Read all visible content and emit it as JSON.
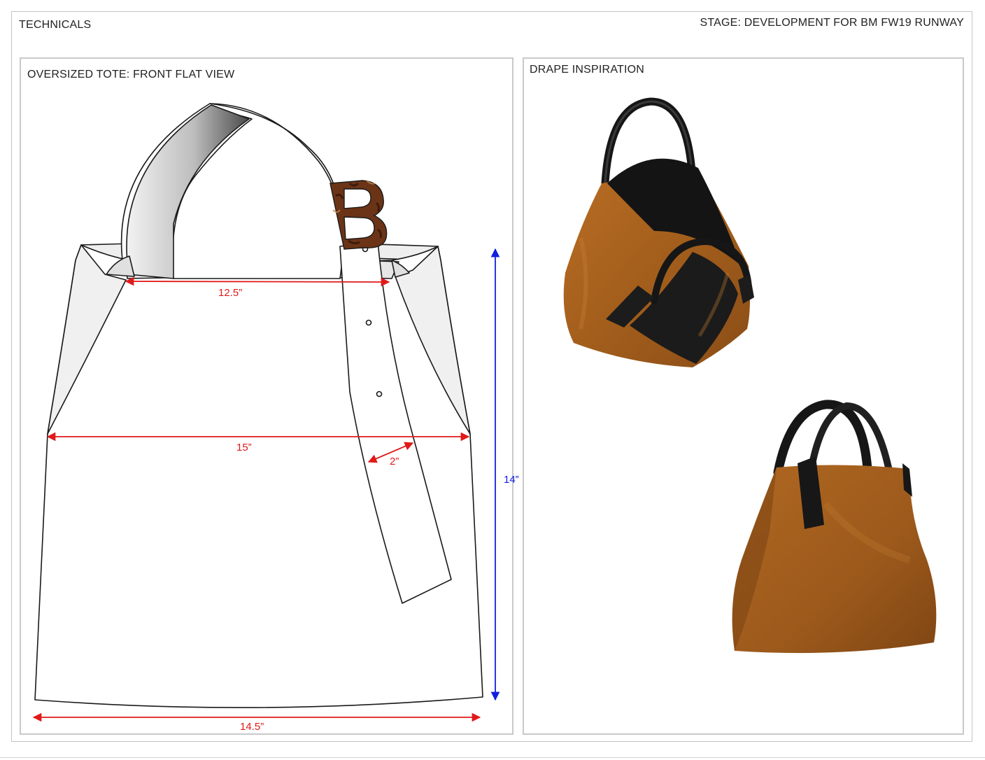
{
  "header": {
    "left_title": "TECHNICALS",
    "stage": "STAGE: DEVELOPMENT FOR BM FW19 RUNWAY"
  },
  "left_panel": {
    "title": "OVERSIZED TOTE: FRONT FLAT VIEW",
    "dimensions": {
      "top_opening": "12.5”",
      "body_width": "15”",
      "strap_width": "2”",
      "height": "14”",
      "bottom_width": "14.5”"
    },
    "buckle_letter": "B"
  },
  "right_panel": {
    "title": "DRAPE INSPIRATION"
  },
  "colors": {
    "dimension_red": "#e01919",
    "dimension_blue": "#1020e0",
    "suede": "#a8621f",
    "leather": "#1a1a1a",
    "tortoise": "#5a2c14"
  }
}
